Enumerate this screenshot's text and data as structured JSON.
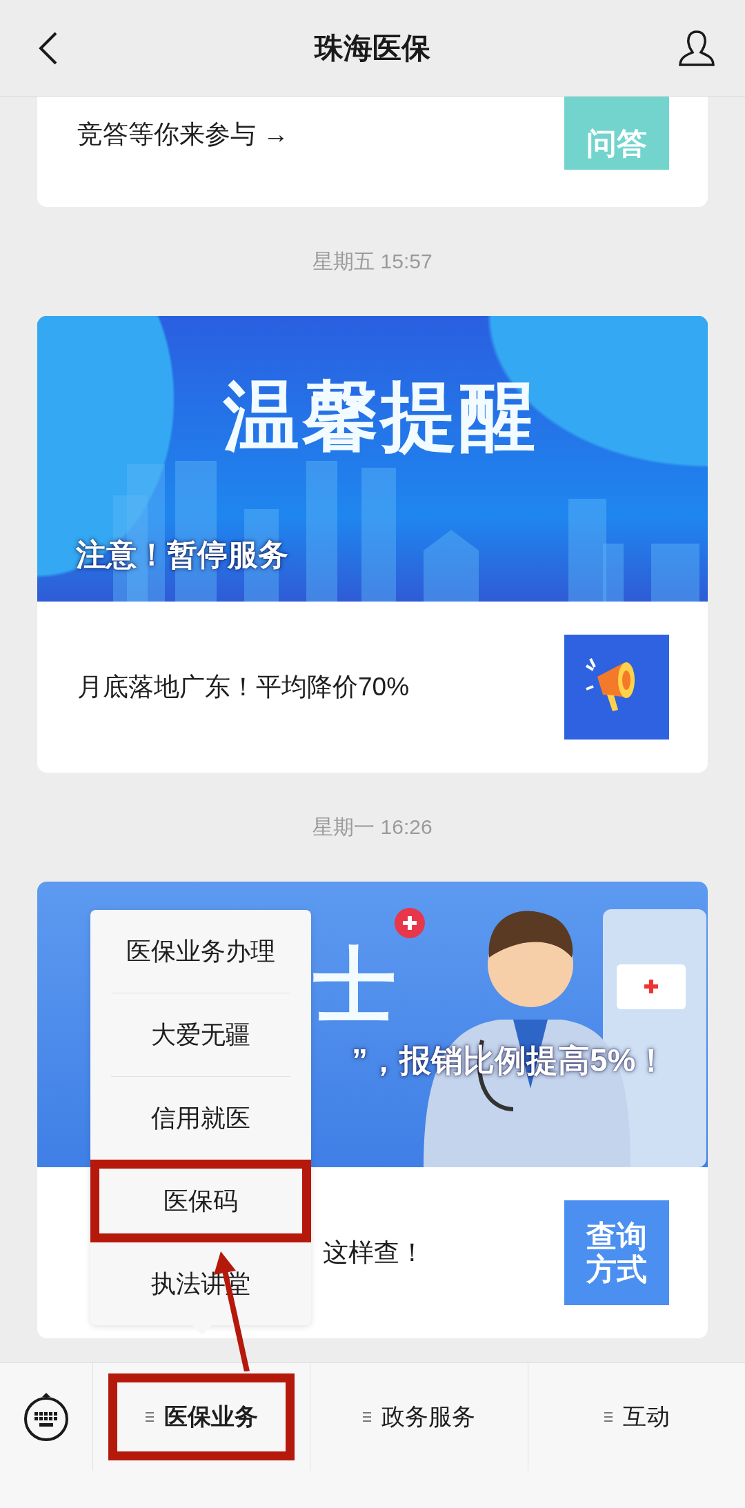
{
  "header": {
    "title": "珠海医保"
  },
  "feed": [
    {
      "kind": "article",
      "summary": "竞答等你来参与 →",
      "thumbnail": {
        "kind": "text",
        "lines": [
          "问答"
        ],
        "color": "#72d4cd"
      }
    },
    {
      "kind": "time",
      "text": "星期五 15:57"
    },
    {
      "kind": "article",
      "banner": {
        "kind": "city",
        "title": "温馨提醒",
        "caption": "注意！暂停服务"
      },
      "summary": "月底落地广东！平均降价70%",
      "thumbnail": {
        "kind": "megaphone",
        "color": "#2f62e0"
      }
    },
    {
      "kind": "time",
      "text": "星期一 16:26"
    },
    {
      "kind": "article",
      "banner": {
        "kind": "doctor",
        "title": "士",
        "caption": "”，报销比例提高5%！"
      },
      "summary": "这样查！",
      "thumbnail": {
        "kind": "text",
        "lines": [
          "查询",
          "方式"
        ],
        "color": "#4b8ff0"
      }
    }
  ],
  "bottom_tabs": [
    {
      "label": "医保业务",
      "expanded": true,
      "highlighted": true,
      "submenu": [
        {
          "label": "医保业务办理",
          "highlighted": false
        },
        {
          "label": "大爱无疆",
          "highlighted": false
        },
        {
          "label": "信用就医",
          "highlighted": false
        },
        {
          "label": "医保码",
          "highlighted": true
        },
        {
          "label": "执法讲堂",
          "highlighted": false
        }
      ]
    },
    {
      "label": "政务服务",
      "expanded": false,
      "highlighted": false
    },
    {
      "label": "互动",
      "expanded": false,
      "highlighted": false
    }
  ]
}
